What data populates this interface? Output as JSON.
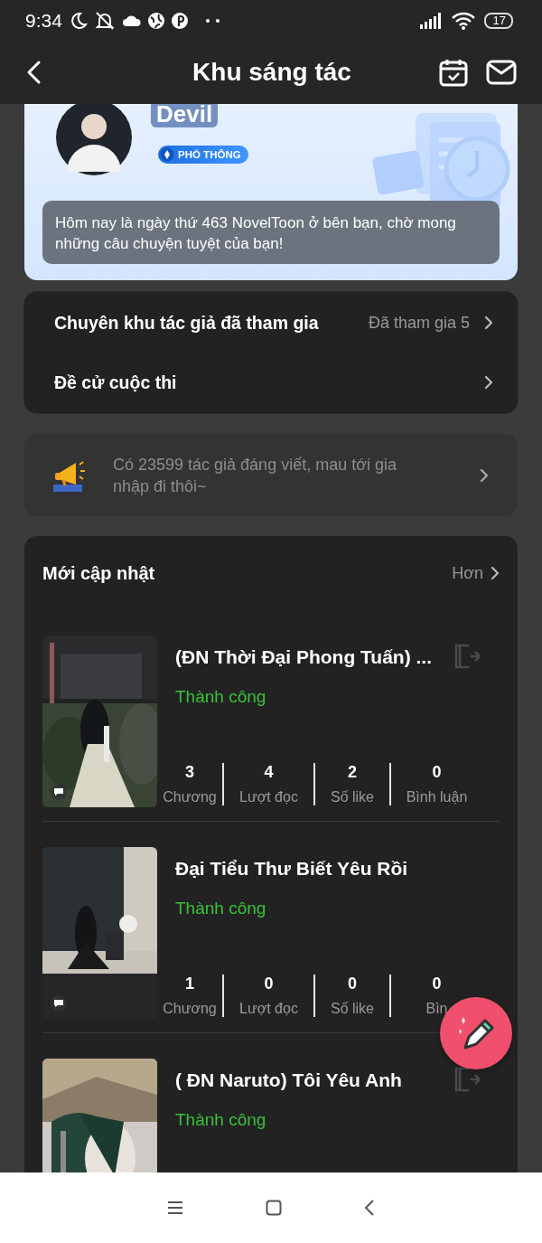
{
  "status_bar": {
    "time": "9:34",
    "battery": "17"
  },
  "header": {
    "title": "Khu sáng tác"
  },
  "profile": {
    "name": "Devil",
    "badge": "PHỔ THÔNG",
    "message": "Hôm nay là ngày thứ 463 NovelToon ở bên bạn, chờ mong những câu chuyện tuyệt của bạn!"
  },
  "menu": [
    {
      "label": "Chuyên khu tác giả đã tham gia",
      "value": "Đã tham gia 5"
    },
    {
      "label": "Đề cử cuộc thi"
    }
  ],
  "promo": {
    "text": "Có 23599 tác giả đáng viết, mau tới gia nhập đi thôi~"
  },
  "updates": {
    "title": "Mới cập nhật",
    "more": "Hơn",
    "books": [
      {
        "title": "(ĐN Thời Đại Phong Tuấn) ...",
        "status": "Thành công",
        "export_icon": true,
        "comment_badge": true,
        "stats": [
          {
            "value": "3",
            "label": "Chương"
          },
          {
            "value": "4",
            "label": "Lượt đọc"
          },
          {
            "value": "2",
            "label": "Số like"
          },
          {
            "value": "0",
            "label": "Bình luận"
          }
        ]
      },
      {
        "title": "Đại Tiểu Thư Biết Yêu Rồi",
        "status": "Thành công",
        "export_icon": false,
        "comment_badge": true,
        "stats": [
          {
            "value": "1",
            "label": "Chương"
          },
          {
            "value": "0",
            "label": "Lượt đọc"
          },
          {
            "value": "0",
            "label": "Số like"
          },
          {
            "value": "0",
            "label": "Bìn"
          }
        ]
      },
      {
        "title": "( ĐN Naruto) Tôi Yêu Anh",
        "status": "Thành công",
        "export_icon": true,
        "comment_badge": false
      }
    ]
  }
}
